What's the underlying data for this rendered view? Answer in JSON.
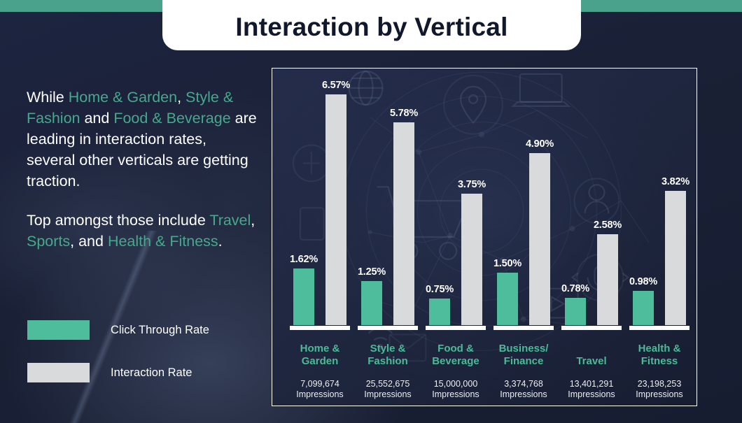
{
  "header": {
    "title": "Interaction by Vertical"
  },
  "colors": {
    "accent_green": "#4ebd9c",
    "band_green": "#4aa28d",
    "label_green": "#4aba97",
    "bar_grey": "#d9dadc",
    "background_navy": "#1a2035",
    "tab_white": "#ffffff"
  },
  "left": {
    "paragraph1": [
      {
        "text": "While ",
        "style": "plain"
      },
      {
        "text": "Home & Garden",
        "style": "highlight"
      },
      {
        "text": ", ",
        "style": "plain"
      },
      {
        "text": "Style & Fashion",
        "style": "highlight"
      },
      {
        "text": " and ",
        "style": "plain"
      },
      {
        "text": "Food & Beverage",
        "style": "highlight"
      },
      {
        "text": " are leading in interaction rates, several other verticals are getting traction.",
        "style": "plain"
      }
    ],
    "paragraph2": [
      {
        "text": "Top amongst those include ",
        "style": "plain"
      },
      {
        "text": "Travel",
        "style": "highlight"
      },
      {
        "text": ", ",
        "style": "plain"
      },
      {
        "text": "Sports",
        "style": "highlight"
      },
      {
        "text": ", and ",
        "style": "plain"
      },
      {
        "text": "Health & Fitness",
        "style": "highlight"
      },
      {
        "text": ".",
        "style": "plain"
      }
    ]
  },
  "legend": {
    "items": [
      {
        "label": "Click Through Rate",
        "color": "#4ebd9c",
        "key": "ctr"
      },
      {
        "label": "Interaction Rate",
        "color": "#d9dadc",
        "key": "ir"
      }
    ]
  },
  "chart_data": {
    "type": "bar",
    "title": "Interaction by Vertical",
    "xlabel": "",
    "ylabel": "",
    "ylim": [
      0,
      6.57
    ],
    "grid": false,
    "legend_position": "left-outside",
    "value_suffix": "%",
    "categories": [
      "Home & Garden",
      "Style & Fashion",
      "Food & Beverage",
      "Business/ Finance",
      "Travel",
      "Health & Fitness"
    ],
    "category_lines": [
      [
        "Home &",
        "Garden"
      ],
      [
        "Style &",
        "Fashion"
      ],
      [
        "Food &",
        "Beverage"
      ],
      [
        "Business/",
        "Finance"
      ],
      [
        "Travel",
        ""
      ],
      [
        "Health &",
        "Fitness"
      ]
    ],
    "impressions": [
      "7,099,674",
      "25,552,675",
      "15,000,000",
      "3,374,768",
      "13,401,291",
      "23,198,253"
    ],
    "impressions_caption": "Impressions",
    "series": [
      {
        "name": "Click Through Rate",
        "color": "#4ebd9c",
        "values": [
          1.62,
          1.25,
          0.75,
          1.5,
          0.78,
          0.98
        ],
        "labels": [
          "1.62%",
          "1.25%",
          "0.75%",
          "1.50%",
          "0.78%",
          "0.98%"
        ]
      },
      {
        "name": "Interaction Rate",
        "color": "#d9dadc",
        "values": [
          6.57,
          5.78,
          3.75,
          4.9,
          2.58,
          3.82
        ],
        "labels": [
          "6.57%",
          "5.78%",
          "3.75%",
          "4.90%",
          "2.58%",
          "3.82%"
        ]
      }
    ]
  }
}
